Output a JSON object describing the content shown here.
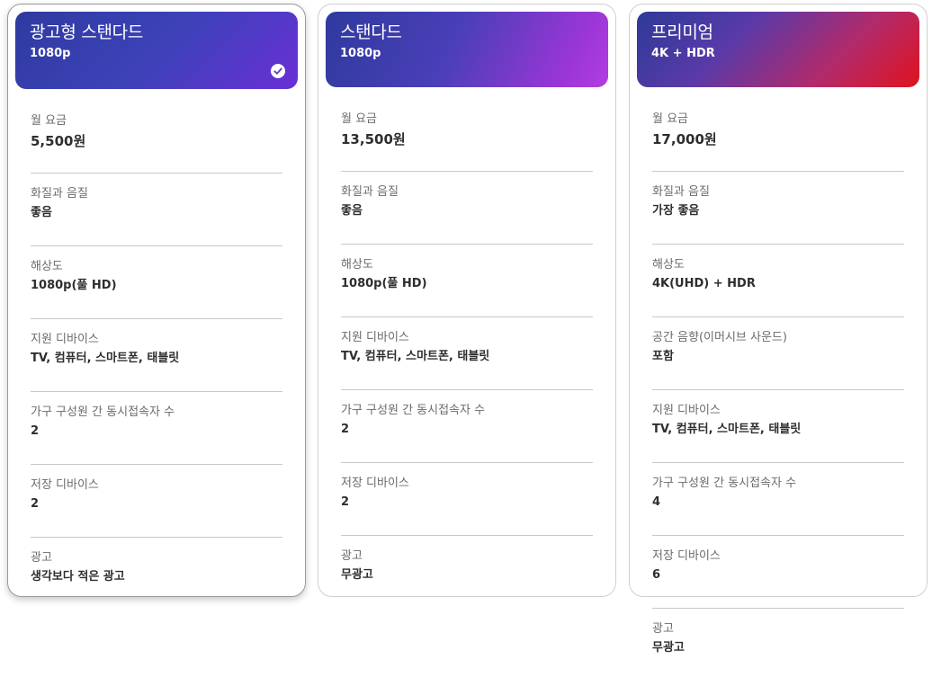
{
  "plans": [
    {
      "name": "광고형 스탠다드",
      "resolution_badge": "1080p",
      "selected": true,
      "rows": [
        {
          "label": "월 요금",
          "value": "5,500원"
        },
        {
          "label": "화질과 음질",
          "value": "좋음"
        },
        {
          "label": "해상도",
          "value": "1080p(풀 HD)"
        },
        {
          "label": "지원 디바이스",
          "value": "TV, 컴퓨터, 스마트폰, 태블릿"
        },
        {
          "label": "가구 구성원 간 동시접속자 수",
          "value": "2"
        },
        {
          "label": "저장 디바이스",
          "value": "2"
        },
        {
          "label": "광고",
          "value": "생각보다 적은 광고"
        }
      ]
    },
    {
      "name": "스탠다드",
      "resolution_badge": "1080p",
      "selected": false,
      "rows": [
        {
          "label": "월 요금",
          "value": "13,500원"
        },
        {
          "label": "화질과 음질",
          "value": "좋음"
        },
        {
          "label": "해상도",
          "value": "1080p(풀 HD)"
        },
        {
          "label": "지원 디바이스",
          "value": "TV, 컴퓨터, 스마트폰, 태블릿"
        },
        {
          "label": "가구 구성원 간 동시접속자 수",
          "value": "2"
        },
        {
          "label": "저장 디바이스",
          "value": "2"
        },
        {
          "label": "광고",
          "value": "무광고"
        }
      ]
    },
    {
      "name": "프리미엄",
      "resolution_badge": "4K + HDR",
      "selected": false,
      "rows": [
        {
          "label": "월 요금",
          "value": "17,000원"
        },
        {
          "label": "화질과 음질",
          "value": "가장 좋음"
        },
        {
          "label": "해상도",
          "value": "4K(UHD) + HDR"
        },
        {
          "label": "공간 음향(이머시브 사운드)",
          "value": "포함"
        },
        {
          "label": "지원 디바이스",
          "value": "TV, 컴퓨터, 스마트폰, 태블릿"
        },
        {
          "label": "가구 구성원 간 동시접속자 수",
          "value": "4"
        },
        {
          "label": "저장 디바이스",
          "value": "6"
        },
        {
          "label": "광고",
          "value": "무광고"
        }
      ]
    }
  ],
  "icons": {
    "selected_check": "check-circle-icon"
  },
  "colors": {
    "basic_gradient": [
      "#2f3aa0",
      "#6a2fd6"
    ],
    "standard_gradient": [
      "#2f3a9e",
      "#b33de0"
    ],
    "premium_gradient": [
      "#2d3a98",
      "#e0121e"
    ]
  }
}
